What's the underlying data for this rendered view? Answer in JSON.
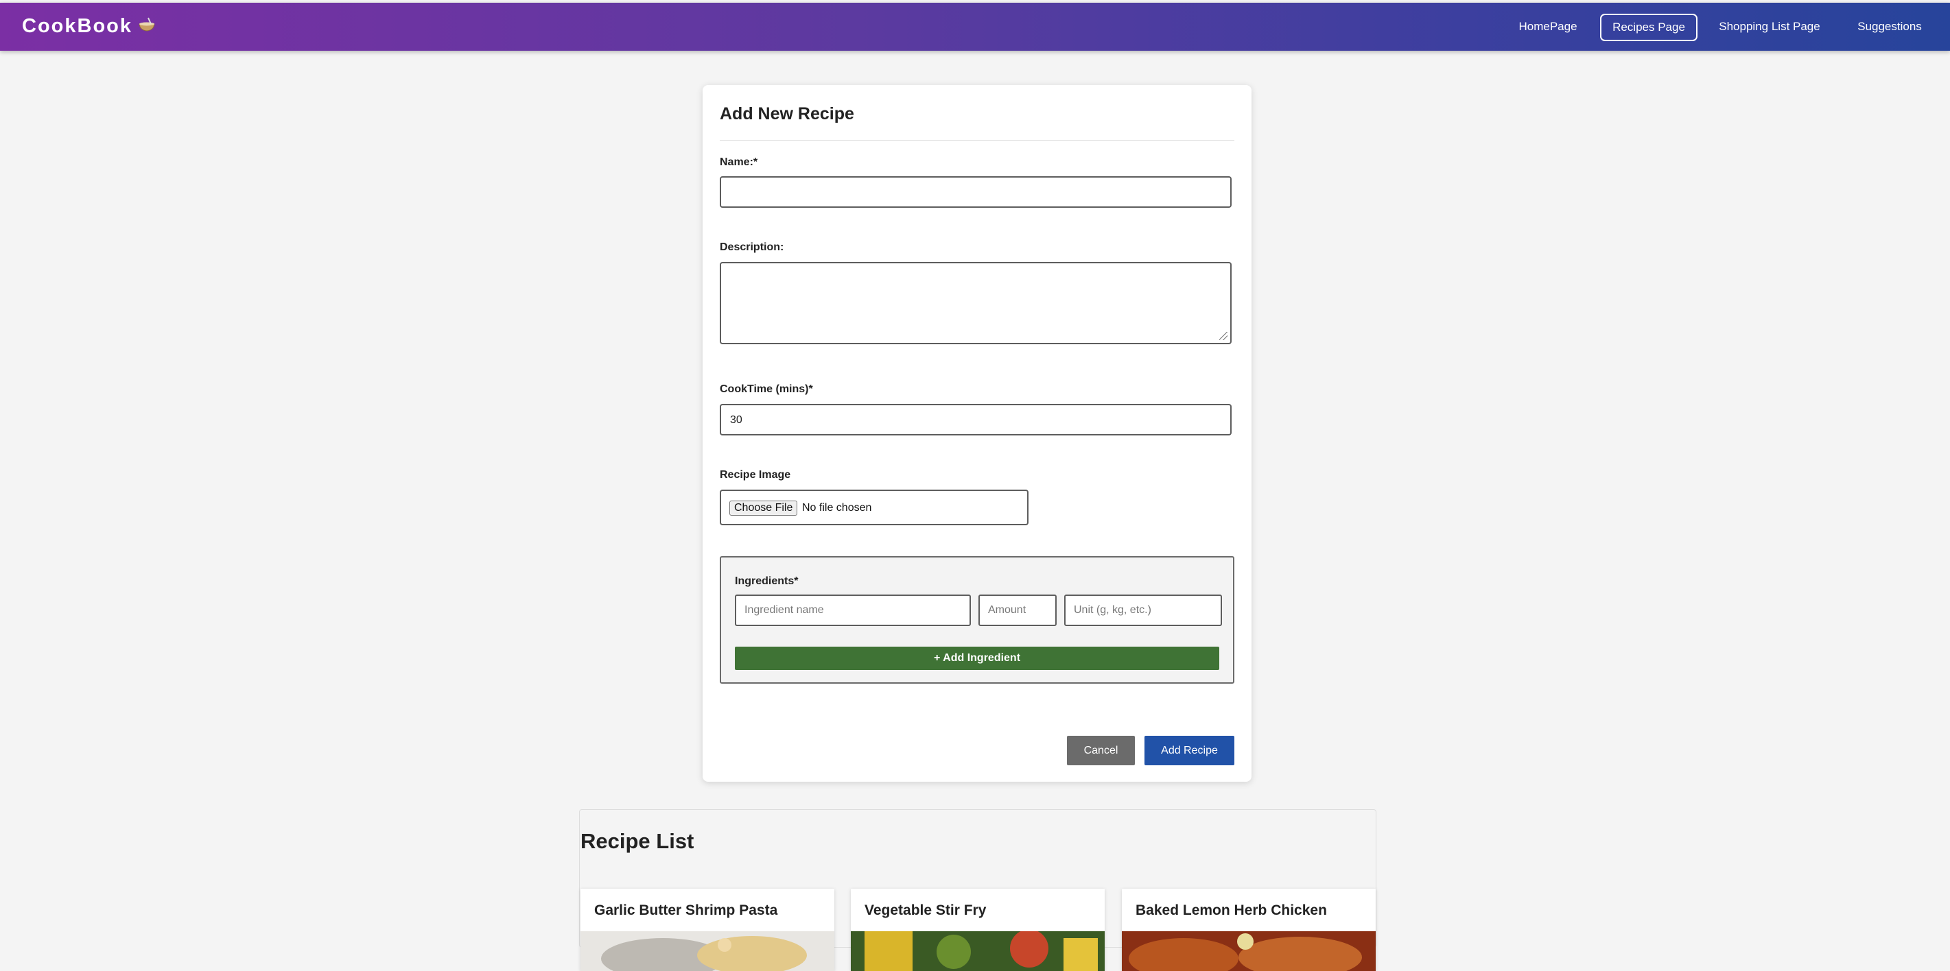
{
  "navbar": {
    "brand": "CookBook",
    "brand_icon": "bowl-with-spoon-icon",
    "links": [
      {
        "label": "HomePage",
        "active": false
      },
      {
        "label": "Recipes Page",
        "active": true
      },
      {
        "label": "Shopping List Page",
        "active": false
      },
      {
        "label": "Suggestions",
        "active": false
      }
    ],
    "gradient_colors": [
      "#7b2fa4",
      "#27449b"
    ]
  },
  "form": {
    "title": "Add New Recipe",
    "name_label": "Name:*",
    "name_value": "",
    "description_label": "Description:",
    "description_value": "",
    "cooktime_label": "CookTime (mins)*",
    "cooktime_value": "30",
    "image_label": "Recipe Image",
    "choose_file_label": "Choose File",
    "file_status": "No file chosen",
    "ingredients_label": "Ingredients*",
    "ingredient_name_placeholder": "Ingredient name",
    "amount_placeholder": "Amount",
    "unit_placeholder": "Unit (g, kg, etc.)",
    "add_ingredient_label": "+ Add Ingredient",
    "cancel_label": "Cancel",
    "submit_label": "Add Recipe",
    "colors": {
      "add_ingredient": "#3f7335",
      "cancel": "#6b6b6b",
      "submit": "#2152a8"
    }
  },
  "recipe_list": {
    "title": "Recipe List",
    "recipes": [
      {
        "title": "Garlic Butter Shrimp Pasta"
      },
      {
        "title": "Vegetable Stir Fry"
      },
      {
        "title": "Baked Lemon Herb Chicken"
      }
    ]
  }
}
